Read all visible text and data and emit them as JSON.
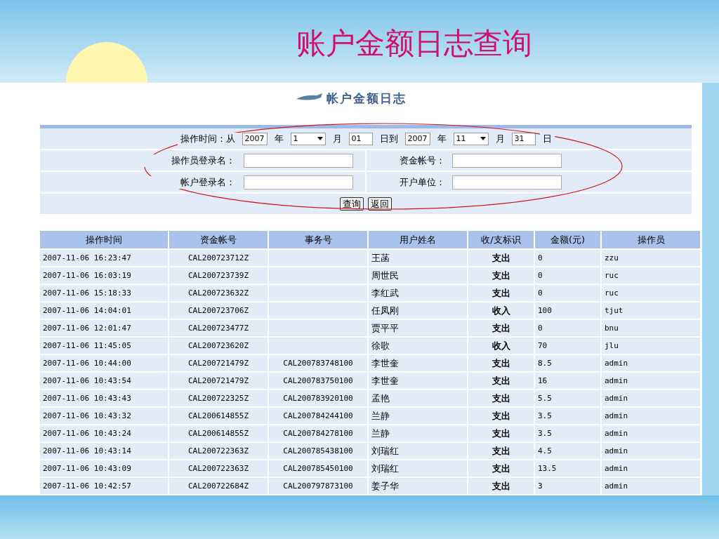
{
  "slide_title": "账户金额日志查询",
  "app": {
    "title": "帐户金额日志",
    "query_form": {
      "date_row": [
        {
          "kind": "label",
          "text": "操作时间：从"
        },
        {
          "kind": "input",
          "value": "2007"
        },
        {
          "kind": "label",
          "text": "年"
        },
        {
          "kind": "select",
          "value": "1"
        },
        {
          "kind": "label",
          "text": "月"
        },
        {
          "kind": "input",
          "value": "01"
        },
        {
          "kind": "label",
          "text": "日到"
        },
        {
          "kind": "input",
          "value": "2007"
        },
        {
          "kind": "label",
          "text": "年"
        },
        {
          "kind": "select",
          "value": "11"
        },
        {
          "kind": "label",
          "text": "月"
        },
        {
          "kind": "input",
          "value": "31"
        },
        {
          "kind": "label",
          "text": "日"
        }
      ],
      "field_rows": [
        [
          {
            "label": "操作员登录名："
          },
          {
            "label": "资金帐号："
          }
        ],
        [
          {
            "label": "帐户登录名："
          },
          {
            "label": "开户单位："
          }
        ]
      ],
      "buttons": [
        "查询",
        "返回"
      ]
    },
    "table": {
      "columns": [
        "操作时间",
        "资金帐号",
        "事务号",
        "用户姓名",
        "收/支标识",
        "金额(元)",
        "操作员"
      ],
      "rows": [
        [
          "2007-11-06 16:23:47",
          "CAL200723712Z",
          null,
          "王菡",
          "支出",
          "0",
          "zzu"
        ],
        [
          "2007-11-06 16:03:19",
          "CAL200723739Z",
          null,
          "周世民",
          "支出",
          "0",
          "ruc"
        ],
        [
          "2007-11-06 15:18:33",
          "CAL200723632Z",
          null,
          "李红武",
          "支出",
          "0",
          "ruc"
        ],
        [
          "2007-11-06 14:04:01",
          "CAL200723706Z",
          null,
          "任凤刚",
          "收入",
          "100",
          "tjut"
        ],
        [
          "2007-11-06 12:01:47",
          "CAL200723477Z",
          null,
          "贾平平",
          "支出",
          "0",
          "bnu"
        ],
        [
          "2007-11-06 11:45:05",
          "CAL200723620Z",
          null,
          "徐歌",
          "收入",
          "70",
          "jlu"
        ],
        [
          "2007-11-06 10:44:00",
          "CAL200721479Z",
          "CAL200783748100",
          "李世奎",
          "支出",
          "8.5",
          "admin"
        ],
        [
          "2007-11-06 10:43:54",
          "CAL200721479Z",
          "CAL200783750100",
          "李世奎",
          "支出",
          "16",
          "admin"
        ],
        [
          "2007-11-06 10:43:43",
          "CAL200722325Z",
          "CAL200783920100",
          "孟艳",
          "支出",
          "5.5",
          "admin"
        ],
        [
          "2007-11-06 10:43:32",
          "CAL200614855Z",
          "CAL200784244100",
          "兰静",
          "支出",
          "3.5",
          "admin"
        ],
        [
          "2007-11-06 10:43:24",
          "CAL200614855Z",
          "CAL200784278100",
          "兰静",
          "支出",
          "3.5",
          "admin"
        ],
        [
          "2007-11-06 10:43:14",
          "CAL200722363Z",
          "CAL200785438100",
          "刘瑞红",
          "支出",
          "4.5",
          "admin"
        ],
        [
          "2007-11-06 10:43:09",
          "CAL200722363Z",
          "CAL200785450100",
          "刘瑞红",
          "支出",
          "13.5",
          "admin"
        ],
        [
          "2007-11-06 10:42:57",
          "CAL200722684Z",
          "CAL200797873100",
          "姜子华",
          "支出",
          "3",
          "admin"
        ]
      ]
    }
  }
}
